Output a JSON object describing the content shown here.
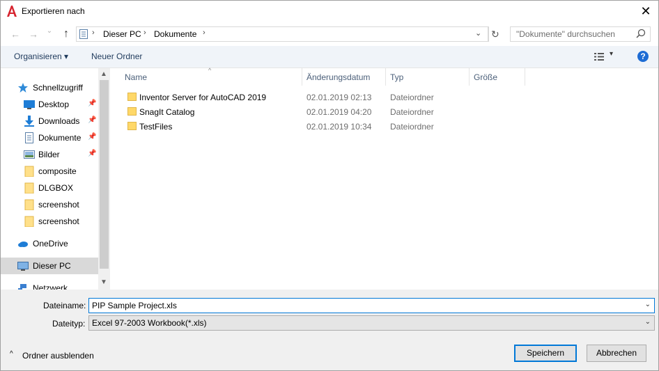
{
  "window": {
    "title": "Exportieren nach",
    "close_glyph": "✕"
  },
  "nav": {
    "back_glyph": "←",
    "forward_glyph": "→",
    "recent_glyph": "⌄",
    "up_glyph": "↑",
    "breadcrumb": [
      "Dieser PC",
      "Dokumente"
    ],
    "breadcrumb_sep": "›",
    "dropdown_glyph": "⌄",
    "refresh_glyph": "↻",
    "search_placeholder": "\"Dokumente\" durchsuchen"
  },
  "toolbar": {
    "organize": "Organisieren ▾",
    "new_folder": "Neuer Ordner",
    "view_drop": "▾",
    "help": "?"
  },
  "navpane": {
    "items": [
      {
        "label": "Schnellzugriff",
        "icon": "star-icon"
      },
      {
        "label": "Desktop",
        "icon": "desktop-icon",
        "pinned": true
      },
      {
        "label": "Downloads",
        "icon": "download-icon",
        "pinned": true
      },
      {
        "label": "Dokumente",
        "icon": "document-icon",
        "pinned": true
      },
      {
        "label": "Bilder",
        "icon": "pictures-icon",
        "pinned": true
      },
      {
        "label": "composite",
        "icon": "folder-icon"
      },
      {
        "label": "DLGBOX",
        "icon": "folder-icon"
      },
      {
        "label": "screenshot",
        "icon": "folder-icon"
      },
      {
        "label": "screenshot",
        "icon": "folder-icon"
      },
      {
        "label": "OneDrive",
        "icon": "cloud-icon"
      },
      {
        "label": "Dieser PC",
        "icon": "computer-icon",
        "selected": true
      },
      {
        "label": "Netzwerk",
        "icon": "network-icon"
      }
    ],
    "pin_glyph": "📌",
    "scroll_up": "▲",
    "scroll_down": "▼"
  },
  "filelist": {
    "columns": [
      "Name",
      "Änderungsdatum",
      "Typ",
      "Größe"
    ],
    "sort_glyph": "^",
    "rows": [
      {
        "name": "Inventor Server for AutoCAD 2019",
        "date": "02.01.2019 02:13",
        "type": "Dateiordner"
      },
      {
        "name": "SnagIt Catalog",
        "date": "02.01.2019 04:20",
        "type": "Dateiordner"
      },
      {
        "name": "TestFiles",
        "date": "02.01.2019 10:34",
        "type": "Dateiordner"
      }
    ]
  },
  "form": {
    "filename_label": "Dateiname:",
    "filename_value": "PIP Sample Project.xls",
    "filetype_label": "Dateityp:",
    "filetype_value": "Excel 97-2003 Workbook(*.xls)",
    "dropdown_glyph": "⌄"
  },
  "footer": {
    "hide_folders": "Ordner ausblenden",
    "hide_glyph": "^",
    "save": "Speichern",
    "cancel": "Abbrechen"
  },
  "colors": {
    "accent": "#0078d7",
    "folder": "#ffd868",
    "selected_bg": "#d9d9d9"
  }
}
